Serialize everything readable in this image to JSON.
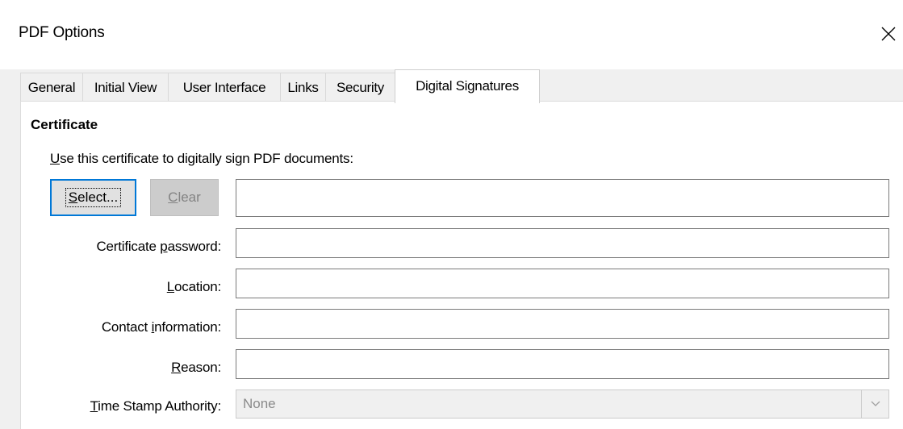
{
  "window": {
    "title": "PDF Options",
    "close_icon": "close-icon"
  },
  "tabs": [
    {
      "label": "General",
      "active": false
    },
    {
      "label": "Initial View",
      "active": false
    },
    {
      "label": "User Interface",
      "active": false
    },
    {
      "label": "Links",
      "active": false
    },
    {
      "label": "Security",
      "active": false
    },
    {
      "label": "Digital Signatures",
      "active": true
    }
  ],
  "certificate": {
    "section_title": "Certificate",
    "hint_accel": "U",
    "hint_rest": "se this certificate to digitally sign PDF documents:",
    "select_accel": "S",
    "select_rest": "elect...",
    "clear_accel": "C",
    "clear_rest": "lear",
    "certificate_value": ""
  },
  "fields": {
    "password": {
      "pre": "Certificate ",
      "accel": "p",
      "post": "assword:",
      "value": ""
    },
    "location": {
      "pre": "",
      "accel": "L",
      "post": "ocation:",
      "value": ""
    },
    "contact": {
      "pre": "Contact ",
      "accel": "i",
      "post": "nformation:",
      "value": ""
    },
    "reason": {
      "pre": "",
      "accel": "R",
      "post": "eason:",
      "value": ""
    },
    "tsa": {
      "pre": "",
      "accel": "T",
      "post": "ime Stamp Authority:",
      "selected": "None",
      "enabled": false
    }
  },
  "colors": {
    "focus_border": "#0078d7",
    "dialog_bg": "#f0f0f0",
    "pane_bg": "#ffffff",
    "disabled_text": "#838383"
  }
}
